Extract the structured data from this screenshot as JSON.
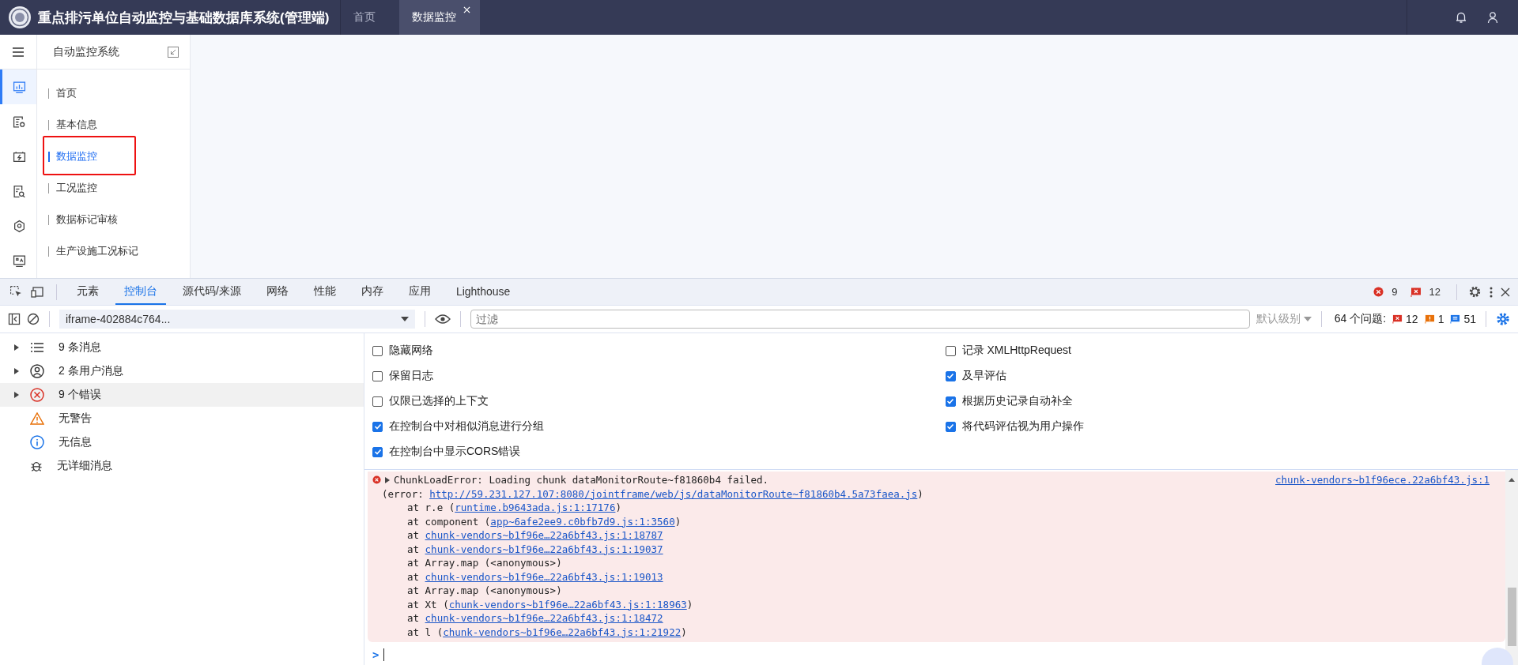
{
  "header": {
    "title": "重点排污单位自动监控与基础数据库系统(管理端)",
    "tabs": [
      {
        "label": "首页",
        "selected": false,
        "closable": false
      },
      {
        "label": "数据监控",
        "selected": true,
        "closable": true
      }
    ]
  },
  "rail": [
    {
      "kind": "chart",
      "selected": true
    },
    {
      "kind": "config",
      "selected": false
    },
    {
      "kind": "battery",
      "selected": false
    },
    {
      "kind": "doc-search",
      "selected": false
    },
    {
      "kind": "location",
      "selected": false
    },
    {
      "kind": "monitor",
      "selected": false
    }
  ],
  "menu": {
    "title": "自动监控系统",
    "items": [
      {
        "label": "首页",
        "selected": false,
        "annotated": false
      },
      {
        "label": "基本信息",
        "selected": false,
        "annotated": false
      },
      {
        "label": "数据监控",
        "selected": true,
        "annotated": true
      },
      {
        "label": "工况监控",
        "selected": false,
        "annotated": false
      },
      {
        "label": "数据标记审核",
        "selected": false,
        "annotated": false
      },
      {
        "label": "生产设施工况标记",
        "selected": false,
        "annotated": false
      }
    ]
  },
  "devtools": {
    "tabs": [
      {
        "label": "元素",
        "selected": false
      },
      {
        "label": "控制台",
        "selected": true
      },
      {
        "label": "源代码/来源",
        "selected": false
      },
      {
        "label": "网络",
        "selected": false
      },
      {
        "label": "性能",
        "selected": false
      },
      {
        "label": "内存",
        "selected": false
      },
      {
        "label": "应用",
        "selected": false
      },
      {
        "label": "Lighthouse",
        "selected": false
      }
    ],
    "error_count": "9",
    "issue_count": "12",
    "toolbar": {
      "context": "iframe-402884c764...",
      "filter_placeholder": "过滤",
      "level": "默认级别",
      "issues_label": "64 个问题:",
      "issues": [
        {
          "kind": "error",
          "count": "12"
        },
        {
          "kind": "warning",
          "count": "1"
        },
        {
          "kind": "info",
          "count": "51"
        }
      ]
    },
    "filters": [
      {
        "kind": "messages",
        "label": "9 条消息",
        "expandable": true,
        "selected": false
      },
      {
        "kind": "user",
        "label": "2 条用户消息",
        "expandable": true,
        "selected": false
      },
      {
        "kind": "error",
        "label": "9 个错误",
        "expandable": true,
        "selected": true
      },
      {
        "kind": "warning",
        "label": "无警告",
        "expandable": false,
        "selected": false
      },
      {
        "kind": "info",
        "label": "无信息",
        "expandable": false,
        "selected": false
      },
      {
        "kind": "verbose",
        "label": "无详细消息",
        "expandable": false,
        "selected": false
      }
    ],
    "settings_left": [
      {
        "label": "隐藏网络",
        "checked": false
      },
      {
        "label": "保留日志",
        "checked": false
      },
      {
        "label": "仅限已选择的上下文",
        "checked": false
      },
      {
        "label": "在控制台中对相似消息进行分组",
        "checked": true
      },
      {
        "label": "在控制台中显示CORS错误",
        "checked": true
      }
    ],
    "settings_right": [
      {
        "label": "记录 XMLHttpRequest",
        "checked": false
      },
      {
        "label": "及早评估",
        "checked": true
      },
      {
        "label": "根据历史记录自动补全",
        "checked": true
      },
      {
        "label": "将代码评估视为用户操作",
        "checked": true
      }
    ],
    "error": {
      "message": "ChunkLoadError: Loading chunk dataMonitorRoute~f81860b4 failed.",
      "source": "chunk-vendors~b1f96ece.22a6bf43.js:1",
      "lines": [
        {
          "indent": false,
          "text": "(error: ",
          "link": "http://59.231.127.107:8080/jointframe/web/js/dataMonitorRoute~f81860b4.5a73faea.js",
          "after": ")"
        },
        {
          "indent": true,
          "text": "at r.e (",
          "link": "runtime.b9643ada.js:1:17176",
          "after": ")"
        },
        {
          "indent": true,
          "text": "at component (",
          "link": "app~6afe2ee9.c0bfb7d9.js:1:3560",
          "after": ")"
        },
        {
          "indent": true,
          "text": "at ",
          "link": "chunk-vendors~b1f96e…22a6bf43.js:1:18787"
        },
        {
          "indent": true,
          "text": "at ",
          "link": "chunk-vendors~b1f96e…22a6bf43.js:1:19037"
        },
        {
          "indent": true,
          "text": "at Array.map (<anonymous>)"
        },
        {
          "indent": true,
          "text": "at ",
          "link": "chunk-vendors~b1f96e…22a6bf43.js:1:19013"
        },
        {
          "indent": true,
          "text": "at Array.map (<anonymous>)"
        },
        {
          "indent": true,
          "text": "at Xt (",
          "link": "chunk-vendors~b1f96e…22a6bf43.js:1:18963",
          "after": ")"
        },
        {
          "indent": true,
          "text": "at ",
          "link": "chunk-vendors~b1f96e…22a6bf43.js:1:18472"
        },
        {
          "indent": true,
          "text": "at l (",
          "link": "chunk-vendors~b1f96e…22a6bf43.js:1:21922",
          "after": ")"
        }
      ]
    },
    "prompt": ">"
  }
}
